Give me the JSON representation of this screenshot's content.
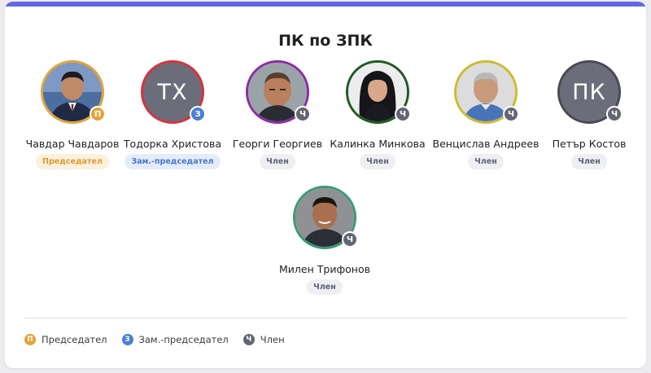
{
  "title": "ПК по ЗПК",
  "colors": {
    "accent_bar": "#6366e0",
    "chair": "#e3a33a",
    "deputy": "#4a7fd6",
    "member": "#636570"
  },
  "members": [
    {
      "name": "Чавдар Чавдаров",
      "role": "Председател",
      "badge": "П",
      "role_type": "chair",
      "ring": "#e3a33a",
      "avatar": "photo-icon"
    },
    {
      "name": "Тодорка Христова",
      "role": "Зам.-председател",
      "badge": "З",
      "role_type": "deputy",
      "ring": "#d6333f",
      "avatar_initials": "ТХ"
    },
    {
      "name": "Георги Георгиев",
      "role": "Член",
      "badge": "Ч",
      "role_type": "member",
      "ring": "#8e2aa3",
      "avatar": "photo-icon"
    },
    {
      "name": "Калинка Минкова",
      "role": "Член",
      "badge": "Ч",
      "role_type": "member",
      "ring": "#1f5a22",
      "avatar": "photo-icon"
    },
    {
      "name": "Венцислав Андреев",
      "role": "Член",
      "badge": "Ч",
      "role_type": "member",
      "ring": "#cdbb2c",
      "avatar": "photo-icon"
    },
    {
      "name": "Петър Костов",
      "role": "Член",
      "badge": "Ч",
      "role_type": "member",
      "ring": "#4a4a52",
      "avatar_initials": "ПК"
    },
    {
      "name": "Милен Трифонов",
      "role": "Член",
      "badge": "Ч",
      "role_type": "member",
      "ring": "#3a9a78",
      "avatar": "photo-icon"
    }
  ],
  "legend": [
    {
      "badge": "П",
      "label": "Председател",
      "role_type": "chair"
    },
    {
      "badge": "З",
      "label": "Зам.-председател",
      "role_type": "deputy"
    },
    {
      "badge": "Ч",
      "label": "Член",
      "role_type": "member"
    }
  ]
}
